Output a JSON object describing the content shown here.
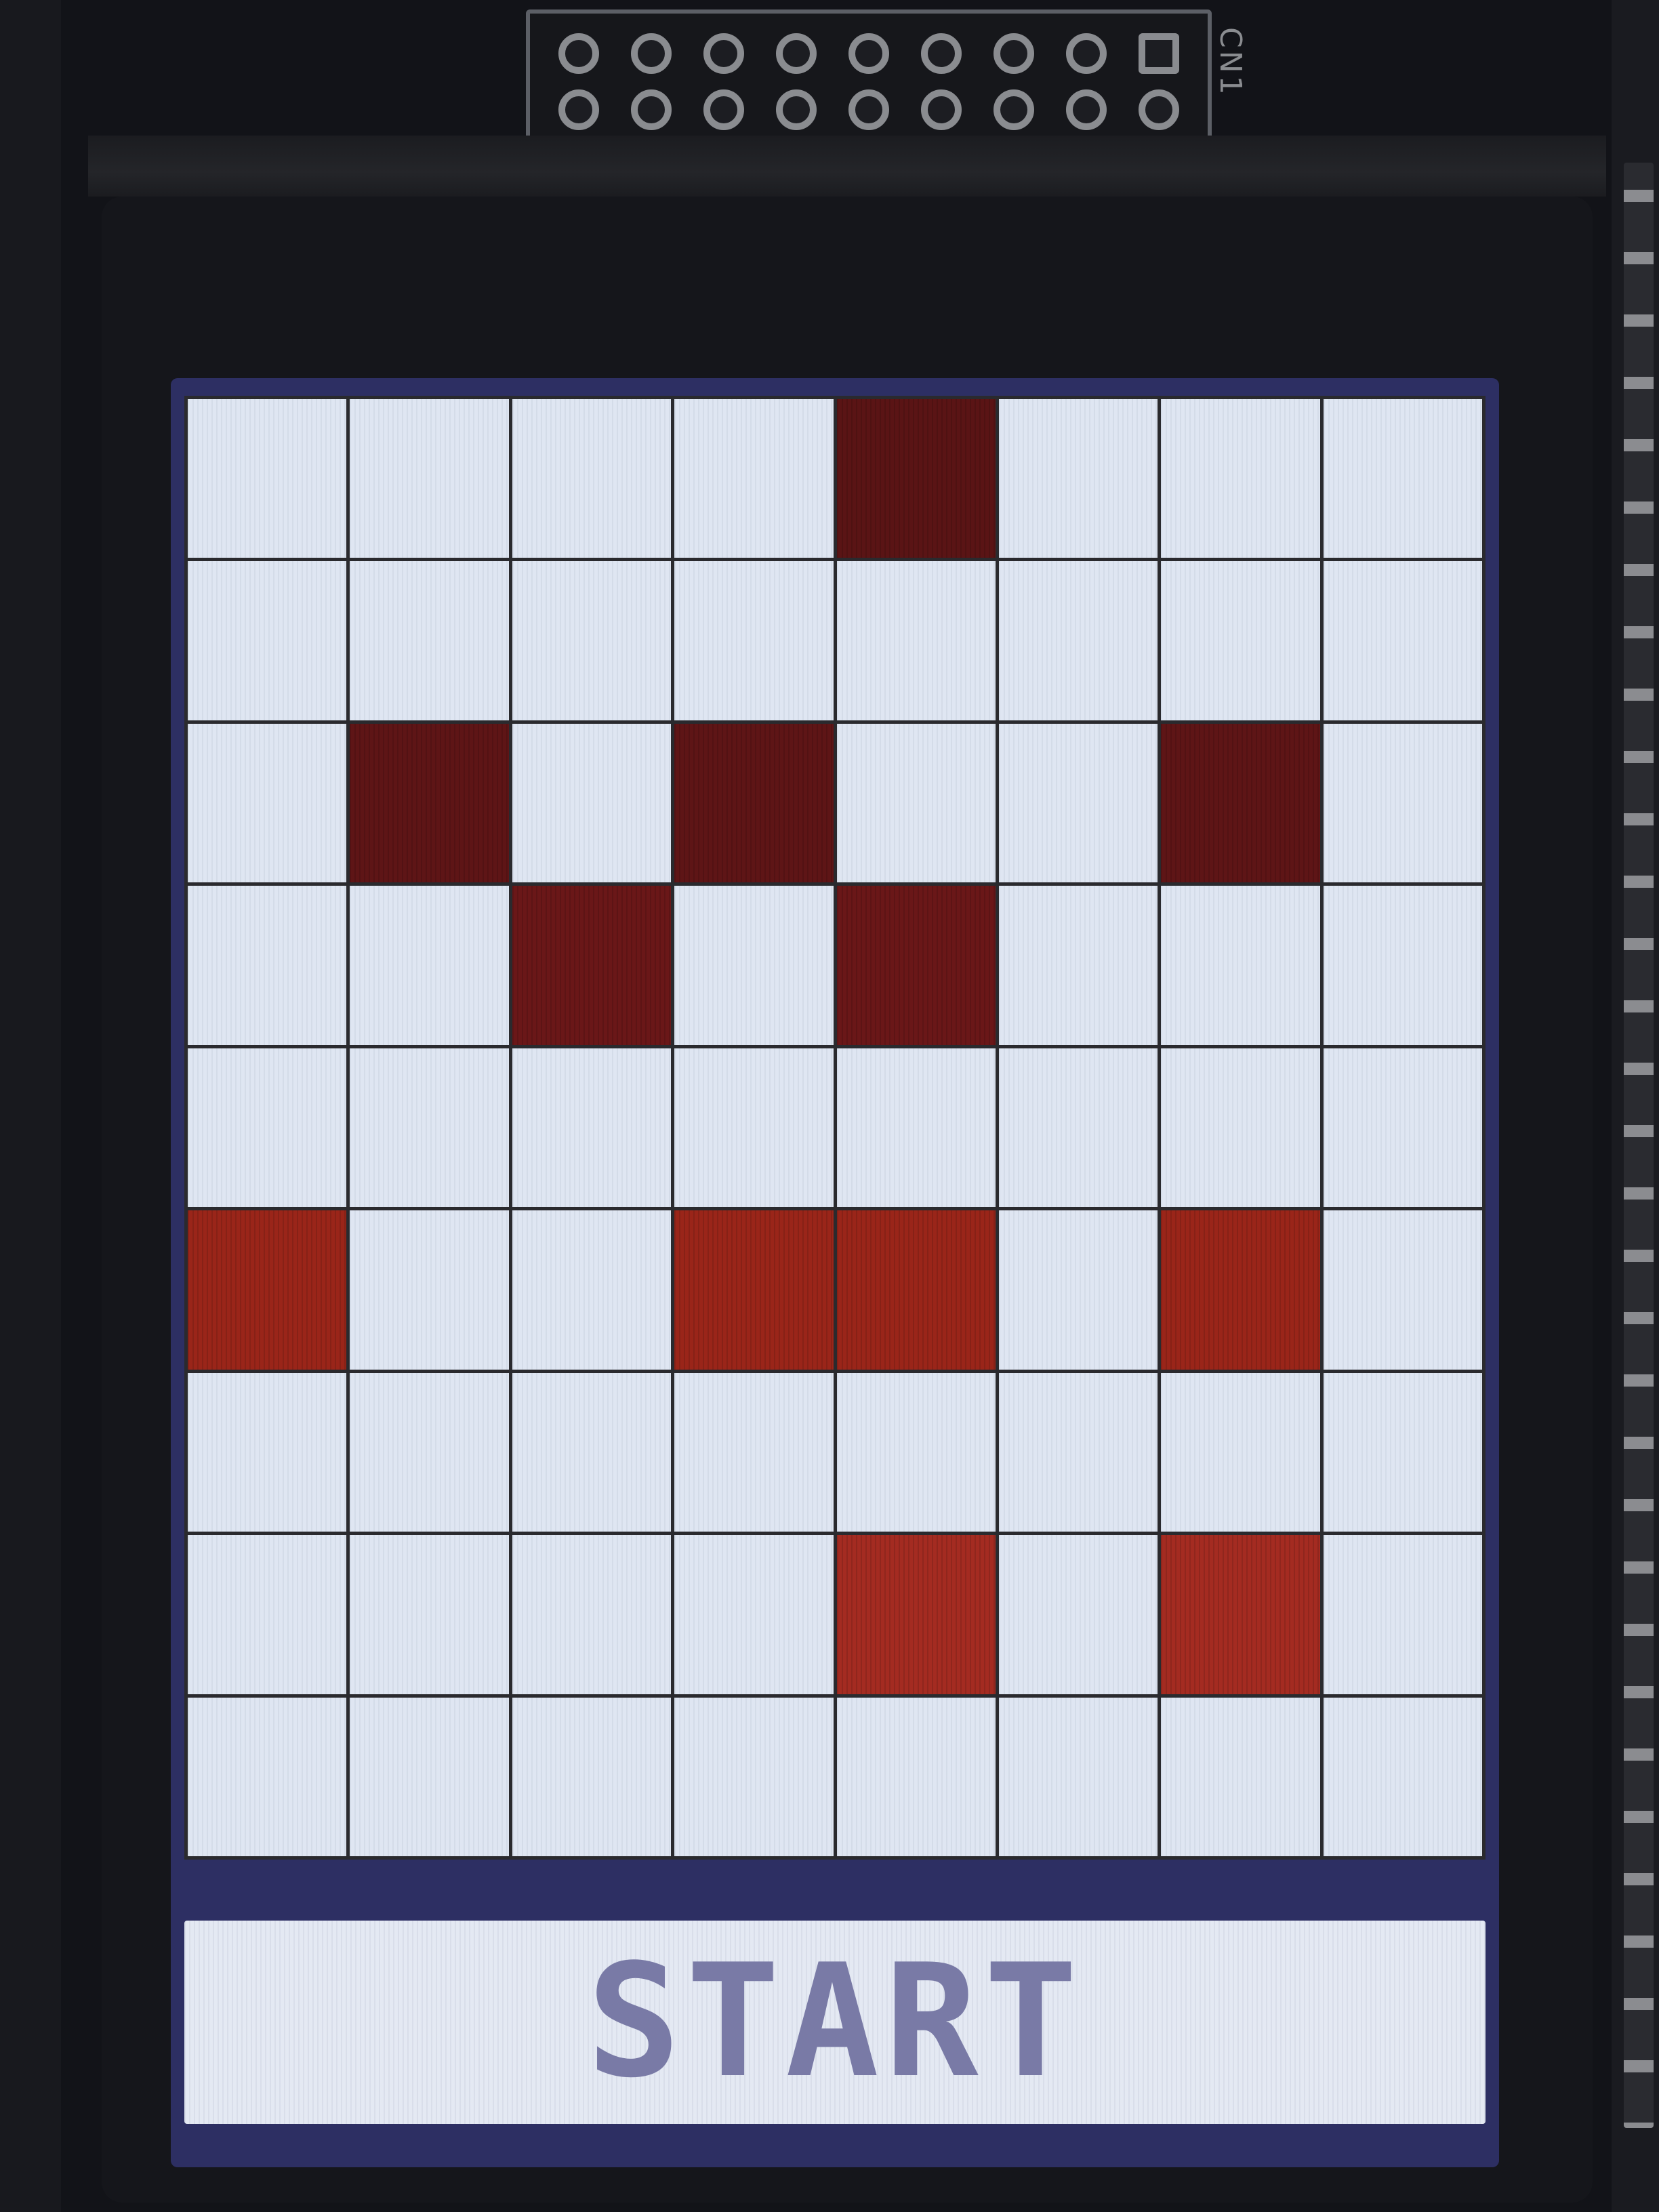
{
  "hardware": {
    "connector_label": "CN1"
  },
  "game": {
    "columns": 8,
    "rows": 9,
    "grid": [
      [
        0,
        0,
        0,
        0,
        1,
        0,
        0,
        0
      ],
      [
        0,
        0,
        0,
        0,
        0,
        0,
        0,
        0
      ],
      [
        0,
        1,
        0,
        1,
        0,
        0,
        1,
        0
      ],
      [
        0,
        0,
        1,
        0,
        1,
        0,
        0,
        0
      ],
      [
        0,
        0,
        0,
        0,
        0,
        0,
        0,
        0
      ],
      [
        1,
        0,
        0,
        1,
        1,
        0,
        1,
        0
      ],
      [
        0,
        0,
        0,
        0,
        0,
        0,
        0,
        0
      ],
      [
        0,
        0,
        0,
        0,
        1,
        0,
        1,
        0
      ],
      [
        0,
        0,
        0,
        0,
        0,
        0,
        0,
        0
      ]
    ],
    "colors": {
      "cell_empty": "#dfe6f2",
      "cell_filled": "#8e2218",
      "grid_lines": "#2a2a2e",
      "screen_border": "#2d2f63",
      "button_text": "#797aa6"
    }
  },
  "controls": {
    "start_label": "START"
  }
}
